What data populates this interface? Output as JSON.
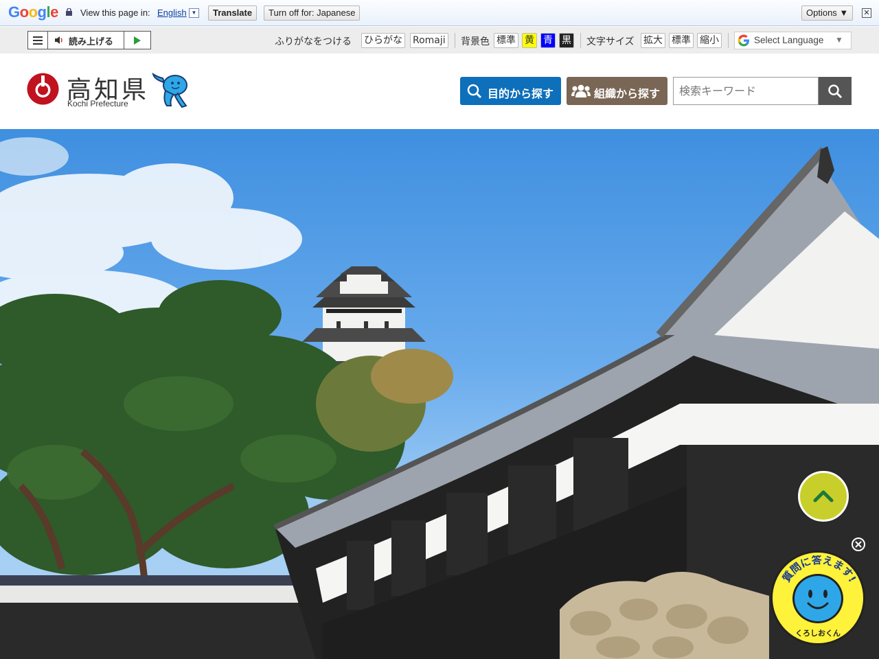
{
  "google_bar": {
    "logo": "Google",
    "view_text": "View this page in:",
    "language": "English",
    "translate_label": "Translate",
    "turnoff_label": "Turn off for: Japanese",
    "options_label": "Options ▼",
    "close_glyph": "✕"
  },
  "toolbar": {
    "read_aloud": "読み上げる",
    "furigana_label": "ふりがなをつける",
    "hiragana": "ひらがな",
    "romaji": "Romaji",
    "bg_color_label": "背景色",
    "bg_standard": "標準",
    "bg_yellow": "黄",
    "bg_blue": "青",
    "bg_black": "黒",
    "font_size_label": "文字サイズ",
    "size_enlarge": "拡大",
    "size_standard": "標準",
    "size_shrink": "縮小",
    "select_language": "Select Language",
    "select_caret": "▼"
  },
  "header": {
    "logo_title": "高知県",
    "logo_subtitle": "Kochi Prefecture",
    "search_purpose": "目的から探す",
    "search_org": "組織から探す",
    "search_placeholder": "検索キーワード"
  },
  "floating": {
    "chatbot_arc_text": "質問に答えます!",
    "chatbot_name": "くろしおくん"
  },
  "colors": {
    "purpose_button": "#0e6fba",
    "org_button": "#7a6655",
    "search_button": "#555555",
    "logo_red": "#c0121f",
    "pagetop": "#c8cf2a",
    "chatbot": "#fff23a"
  },
  "icons": [
    "lock-icon",
    "hamburger-icon",
    "speaker-icon",
    "play-icon",
    "google-g-icon",
    "search-icon",
    "people-icon",
    "chevron-up-icon",
    "close-icon"
  ]
}
